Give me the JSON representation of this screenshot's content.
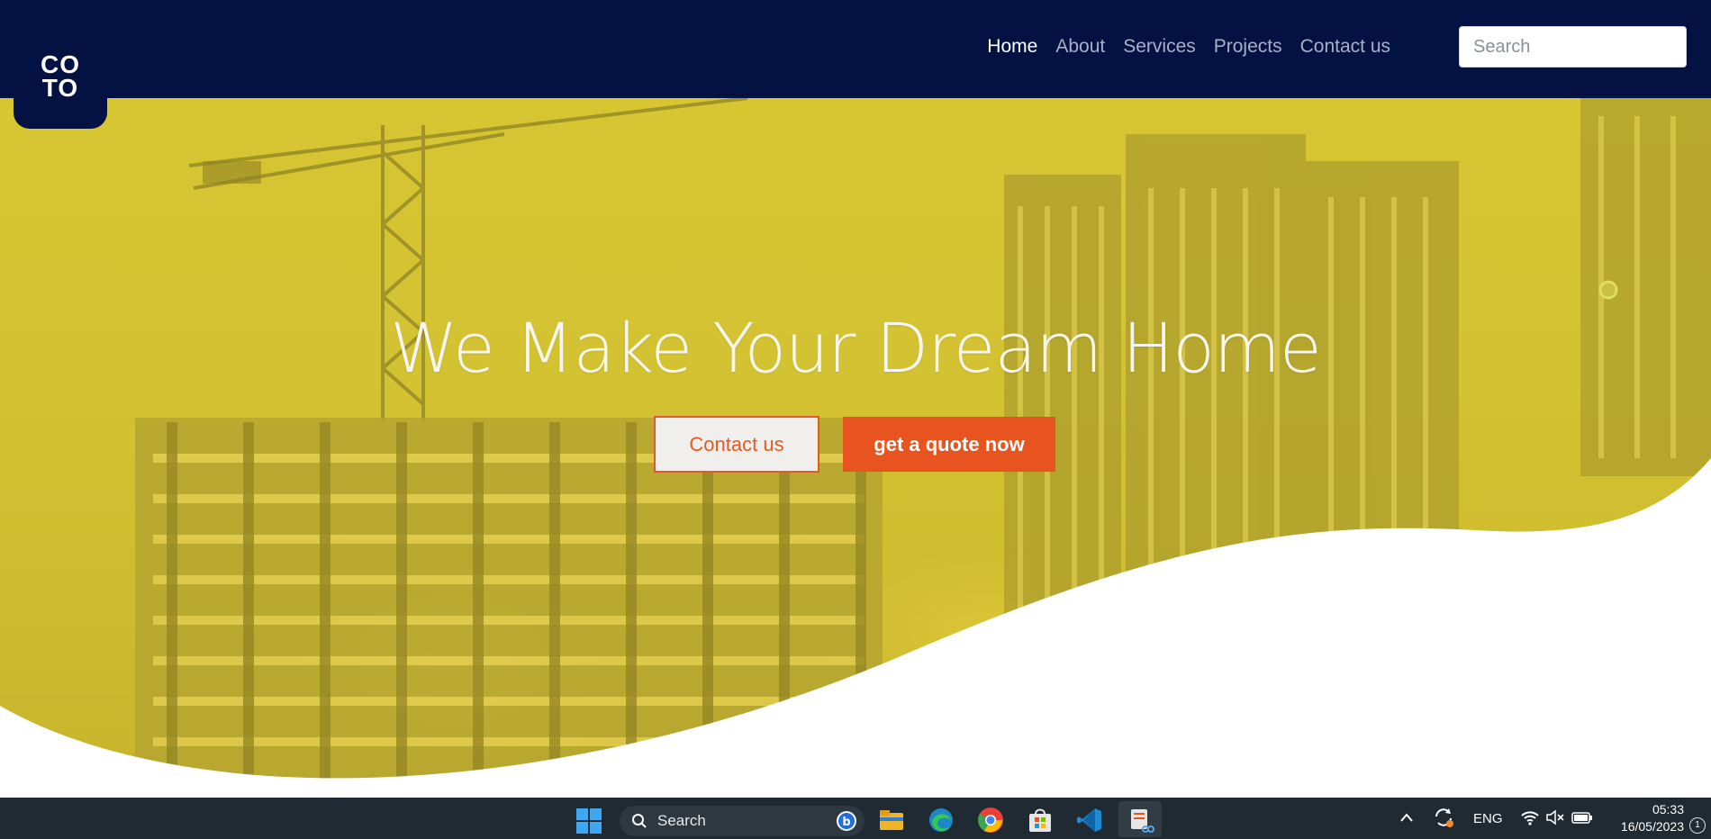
{
  "brand": {
    "logo_line1": "CO",
    "logo_line2": "TO"
  },
  "nav": {
    "items": [
      {
        "label": "Home",
        "active": true
      },
      {
        "label": "About",
        "active": false
      },
      {
        "label": "Services",
        "active": false
      },
      {
        "label": "Projects",
        "active": false
      },
      {
        "label": "Contact us",
        "active": false
      }
    ],
    "search_placeholder": "Search"
  },
  "hero": {
    "title": "We Make Your Dream Home",
    "contact_button": "Contact us",
    "quote_button": "get a quote now"
  },
  "colors": {
    "header_bg": "#031243",
    "hero_overlay": "#d3c232",
    "accent": "#e8541f",
    "taskbar_bg": "#1f2a32"
  },
  "taskbar": {
    "search_label": "Search",
    "pinned_apps": [
      "file-explorer-icon",
      "edge-icon",
      "chrome-icon",
      "store-icon",
      "vscode-icon",
      "snipping-tool-icon"
    ],
    "tray": {
      "language": "ENG",
      "time": "05:33",
      "date": "16/05/2023",
      "notification_count": "1"
    }
  }
}
